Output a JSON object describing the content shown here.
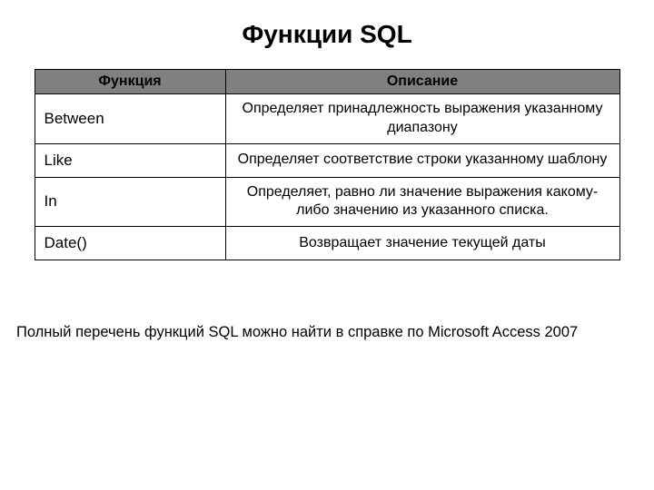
{
  "title": "Функции SQL",
  "table": {
    "headers": {
      "func": "Функция",
      "desc": "Описание"
    },
    "rows": [
      {
        "func": "Between",
        "desc": "Определяет принадлежность выражения указанному диапазону"
      },
      {
        "func": "Like",
        "desc": "Определяет соответствие строки указанному шаблону"
      },
      {
        "func": "In",
        "desc": "Определяет, равно ли значение выражения какому-либо значению из указанного списка."
      },
      {
        "func": "Date()",
        "desc": "Возвращает значение текущей даты"
      }
    ]
  },
  "footnote": "Полный перечень функций SQL можно найти в справке по Microsoft Access 2007"
}
